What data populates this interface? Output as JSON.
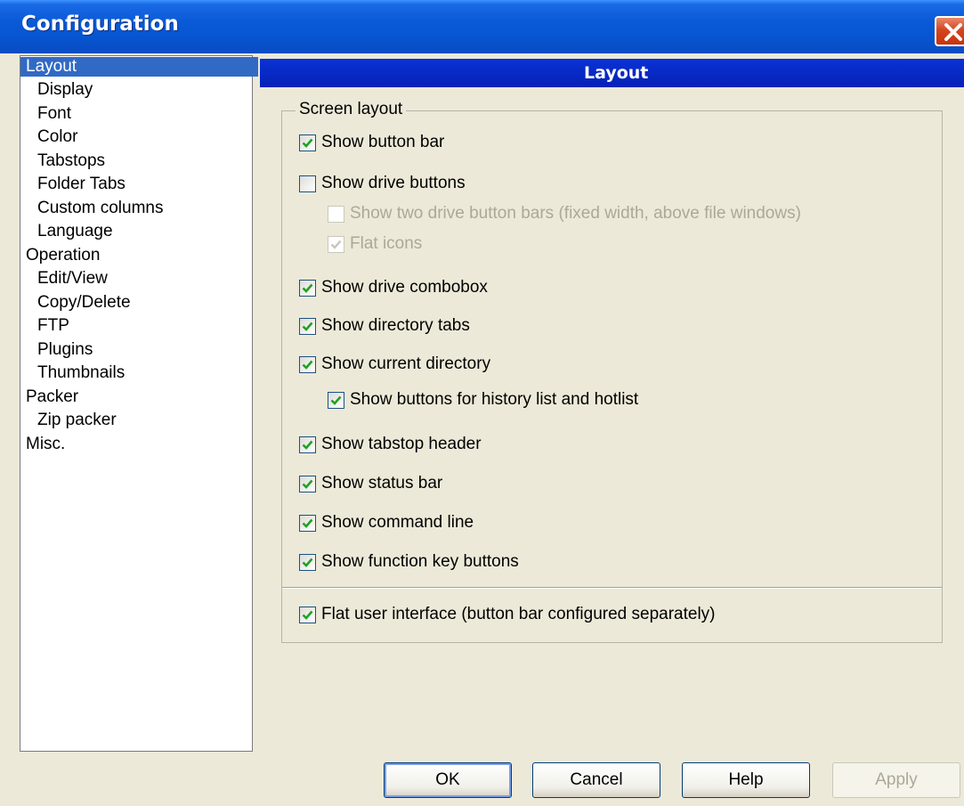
{
  "window": {
    "title": "Configuration"
  },
  "tree": {
    "items": [
      {
        "label": "Layout",
        "level": 0,
        "selected": true
      },
      {
        "label": "Display",
        "level": 1
      },
      {
        "label": "Font",
        "level": 1
      },
      {
        "label": "Color",
        "level": 1
      },
      {
        "label": "Tabstops",
        "level": 1
      },
      {
        "label": "Folder Tabs",
        "level": 1
      },
      {
        "label": "Custom columns",
        "level": 1
      },
      {
        "label": "Language",
        "level": 1
      },
      {
        "label": "Operation",
        "level": 0
      },
      {
        "label": "Edit/View",
        "level": 1
      },
      {
        "label": "Copy/Delete",
        "level": 1
      },
      {
        "label": "FTP",
        "level": 1
      },
      {
        "label": "Plugins",
        "level": 1
      },
      {
        "label": "Thumbnails",
        "level": 1
      },
      {
        "label": "Packer",
        "level": 0
      },
      {
        "label": "Zip packer",
        "level": 1
      },
      {
        "label": "Misc.",
        "level": 0
      }
    ]
  },
  "panel": {
    "header": "Layout",
    "group_label": "Screen layout",
    "options": [
      {
        "label": "Show button bar",
        "checked": true,
        "enabled": true
      },
      {
        "label": "Show drive buttons",
        "checked": false,
        "enabled": true
      },
      {
        "label": "Show two drive button bars (fixed width, above file windows)",
        "checked": false,
        "enabled": false
      },
      {
        "label": "Flat icons",
        "checked": true,
        "enabled": false
      },
      {
        "label": "Show drive combobox",
        "checked": true,
        "enabled": true
      },
      {
        "label": "Show directory tabs",
        "checked": true,
        "enabled": true
      },
      {
        "label": "Show current directory",
        "checked": true,
        "enabled": true
      },
      {
        "label": "Show buttons for history list and hotlist",
        "checked": true,
        "enabled": true
      },
      {
        "label": "Show tabstop header",
        "checked": true,
        "enabled": true
      },
      {
        "label": "Show status bar",
        "checked": true,
        "enabled": true
      },
      {
        "label": "Show command line",
        "checked": true,
        "enabled": true
      },
      {
        "label": "Show function key buttons",
        "checked": true,
        "enabled": true
      },
      {
        "label": "Flat user interface (button bar configured separately)",
        "checked": true,
        "enabled": true
      }
    ]
  },
  "buttons": {
    "ok": "OK",
    "cancel": "Cancel",
    "help": "Help",
    "apply": "Apply"
  }
}
